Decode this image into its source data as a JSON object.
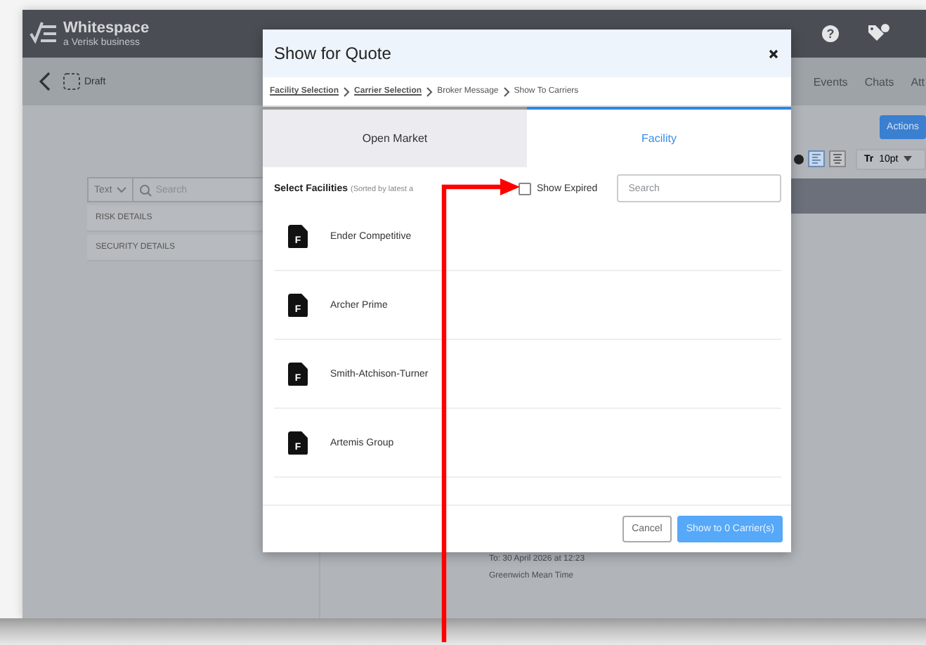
{
  "app": {
    "logo": {
      "name": "Whitespace",
      "tagline": "a Verisk business"
    },
    "draft_label": "Draft",
    "help_glyph": "?",
    "tabs": [
      {
        "label": "Events"
      },
      {
        "label": "Chats"
      },
      {
        "label": "Att"
      }
    ],
    "font_size_icon": "Tr",
    "actions_button": "Actions",
    "font_size": "10pt",
    "left_panel": {
      "filter": "Text",
      "search_placeholder": "Search",
      "sections": [
        "RISK DETAILS",
        "SECURITY DETAILS"
      ]
    },
    "detail_lines": [
      "To: 30 April 2026 at 12:23",
      "Greenwich Mean Time"
    ]
  },
  "dialog": {
    "title": "Show for Quote",
    "breadcrumb": [
      {
        "label": "Facility Selection",
        "link": true
      },
      {
        "label": "Carrier Selection",
        "link": true
      },
      {
        "label": "Broker Message",
        "link": false
      },
      {
        "label": "Show To Carriers",
        "link": false
      }
    ],
    "tabs": [
      {
        "label": "Open Market",
        "selected": false
      },
      {
        "label": "Facility",
        "selected": true
      }
    ],
    "list_title": "Select Facilities",
    "list_note": "(Sorted by latest a",
    "show_expired": {
      "label": "Show Expired",
      "checked": false
    },
    "search": {
      "placeholder": "Search"
    },
    "facilities": [
      {
        "name": "Ender Competitive",
        "badge": "F"
      },
      {
        "name": "Archer Prime",
        "badge": "F"
      },
      {
        "name": "Smith-Atchison-Turner",
        "badge": "F"
      },
      {
        "name": "Artemis Group",
        "badge": "F"
      }
    ],
    "buttons": [
      {
        "label": "Cancel",
        "kind": "secondary"
      },
      {
        "label": "Show to 0 Carrier(s)",
        "kind": "primary"
      }
    ]
  }
}
